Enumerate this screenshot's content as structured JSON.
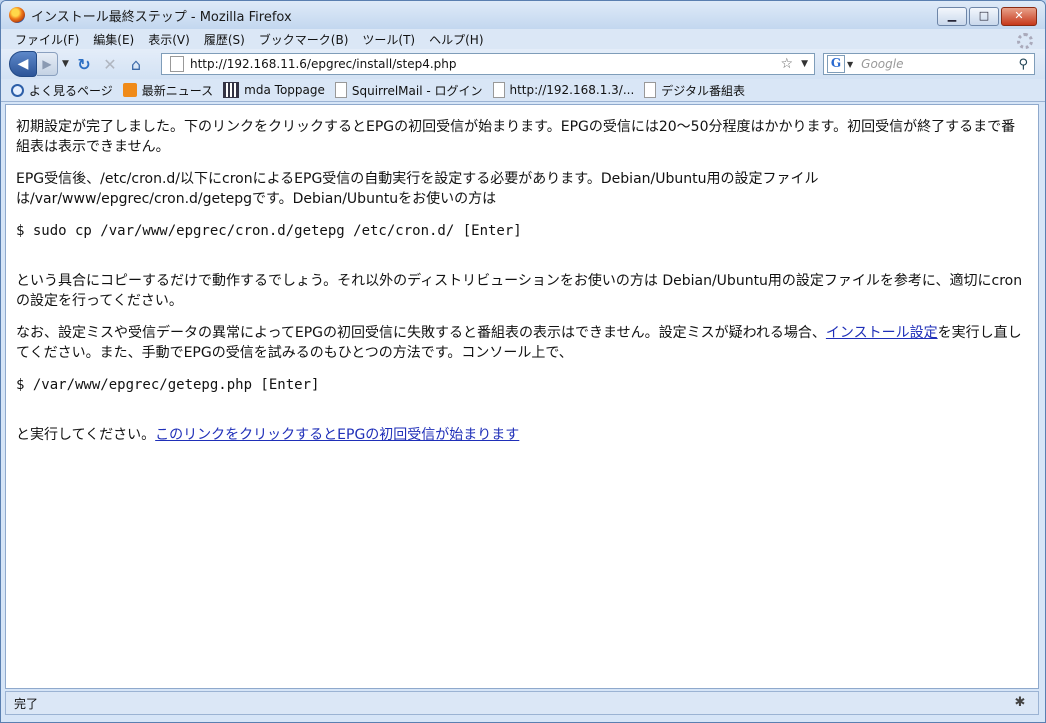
{
  "window": {
    "title": "インストール最終ステップ - Mozilla Firefox"
  },
  "menu": [
    "ファイル(F)",
    "編集(E)",
    "表示(V)",
    "履歴(S)",
    "ブックマーク(B)",
    "ツール(T)",
    "ヘルプ(H)"
  ],
  "nav": {
    "url": "http://192.168.11.6/epgrec/install/step4.php",
    "search_placeholder": "Google"
  },
  "bookmarks": [
    "よく見るページ",
    "最新ニュース",
    "mda Toppage",
    "SquirrelMail - ログイン",
    "http://192.168.1.3/...",
    "デジタル番組表"
  ],
  "icons": {
    "back": "arrow-left-icon",
    "forward": "arrow-right-icon",
    "reload": "reload-icon",
    "stop": "stop-icon",
    "home": "home-icon",
    "star": "star-icon",
    "search": "magnifier-icon"
  },
  "page": {
    "p1": "初期設定が完了しました。下のリンクをクリックするとEPGの初回受信が始まります。EPGの受信には20〜50分程度はかかります。初回受信が終了するまで番組表は表示できません。",
    "p2": "EPG受信後、/etc/cron.d/以下にcronによるEPG受信の自動実行を設定する必要があります。Debian/Ubuntu用の設定ファイルは/var/www/epgrec/cron.d/getepgです。Debian/Ubuntuをお使いの方は",
    "code1": "$ sudo cp /var/www/epgrec/cron.d/getepg /etc/cron.d/ [Enter]",
    "p3": "という具合にコピーするだけで動作するでしょう。それ以外のディストリビューションをお使いの方は Debian/Ubuntu用の設定ファイルを参考に、適切にcronの設定を行ってください。",
    "p4_pre": "なお、設定ミスや受信データの異常によってEPGの初回受信に失敗すると番組表の表示はできません。設定ミスが疑われる場合、",
    "p4_link": "インストール設定",
    "p4_post": "を実行し直してください。また、手動でEPGの受信を試みるのもひとつの方法です。コンソール上で、",
    "code2": "$ /var/www/epgrec/getepg.php [Enter]",
    "p5_pre": "と実行してください。",
    "p5_link": "このリンクをクリックするとEPGの初回受信が始まります"
  },
  "status": {
    "text": "完了"
  }
}
